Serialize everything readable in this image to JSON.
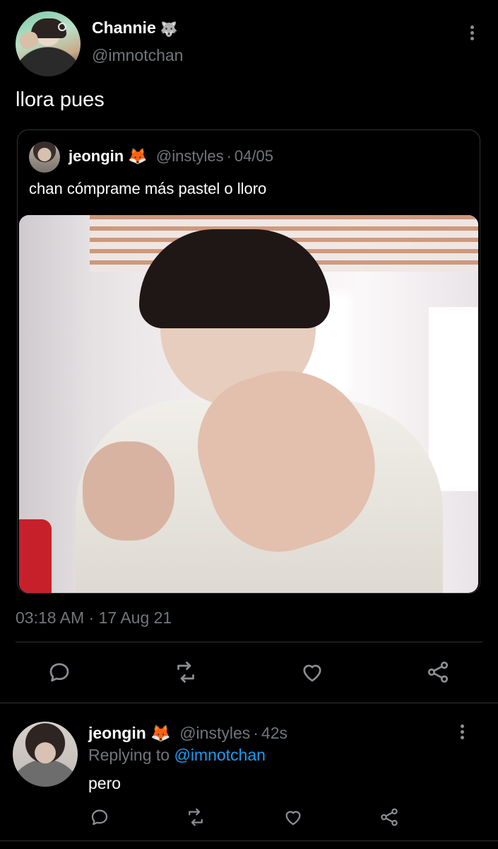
{
  "main_tweet": {
    "author_name": "Channie",
    "author_badge_emoji": "🐺",
    "author_handle": "@imnotchan",
    "text": "llora pues",
    "timestamp": "03:18 AM · 17 Aug 21",
    "icons": {
      "more": "more-vertical-icon",
      "reply": "reply-icon",
      "retweet": "retweet-icon",
      "like": "heart-icon",
      "share": "share-icon"
    }
  },
  "quoted_tweet": {
    "author_name": "jeongin",
    "author_badge_emoji": "🦊",
    "author_handle": "@instyles",
    "date": "04/05",
    "text": "chan cómprame más pastel o lloro"
  },
  "reply_tweet": {
    "author_name": "jeongin",
    "author_badge_emoji": "🦊",
    "author_handle": "@instyles",
    "time_ago": "42s",
    "replying_to_label": "Replying to",
    "replying_to_handle": "@imnotchan",
    "text": "pero"
  },
  "colors": {
    "background": "#000000",
    "text_primary": "#e7e9ea",
    "text_secondary": "#71767b",
    "link": "#1d9bf0",
    "divider": "#2f3336"
  }
}
